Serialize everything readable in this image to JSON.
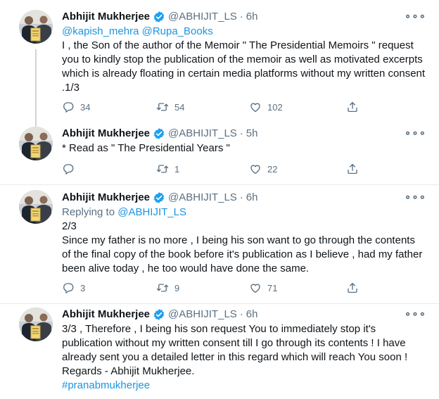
{
  "tweets": [
    {
      "name": "Abhijit Mukherjee",
      "handle": "@ABHIJIT_LS",
      "time": "6h",
      "mentions": "@kapish_mehra @Rupa_Books",
      "text": "I , the Son of the author of the Memoir \" The Presidential Memoirs \" request you to kindly stop the publication of the memoir as well as motivated excerpts which is already floating in certain media platforms without my written consent .1/3",
      "replies": "34",
      "retweets": "54",
      "likes": "102"
    },
    {
      "name": "Abhijit Mukherjee",
      "handle": "@ABHIJIT_LS",
      "time": "5h",
      "text": "* Read as \" The Presidential Years \"",
      "replies": "",
      "retweets": "1",
      "likes": "22"
    },
    {
      "name": "Abhijit Mukherjee",
      "handle": "@ABHIJIT_LS",
      "time": "6h",
      "replying_label": "Replying to",
      "replying_handle": "@ABHIJIT_LS",
      "counter": "2/3",
      "text": "Since my father is no more , I being his son want to go through the contents of the final copy of the book before it's publication as I believe , had my father been alive today , he too would have done the same.",
      "replies": "3",
      "retweets": "9",
      "likes": "71"
    },
    {
      "name": "Abhijit Mukherjee",
      "handle": "@ABHIJIT_LS",
      "time": "6h",
      "text": "3/3 , Therefore , I being his son request You to immediately stop it's publication without my written consent till I go through its contents ! I have already sent you a detailed letter in this regard which will reach You soon ! Regards - Abhijit Mukherjee.",
      "hashtag": "#pranabmukherjee"
    }
  ],
  "ui": {
    "dot": "·",
    "more": "∘∘∘"
  },
  "colors": {
    "link": "#1b95e0",
    "verified": "#1da1f2",
    "muted": "#5b7083",
    "divider": "#e6ecf0"
  },
  "icons": [
    "reply-icon",
    "retweet-icon",
    "like-icon",
    "share-icon",
    "verified-icon",
    "more-icon"
  ]
}
